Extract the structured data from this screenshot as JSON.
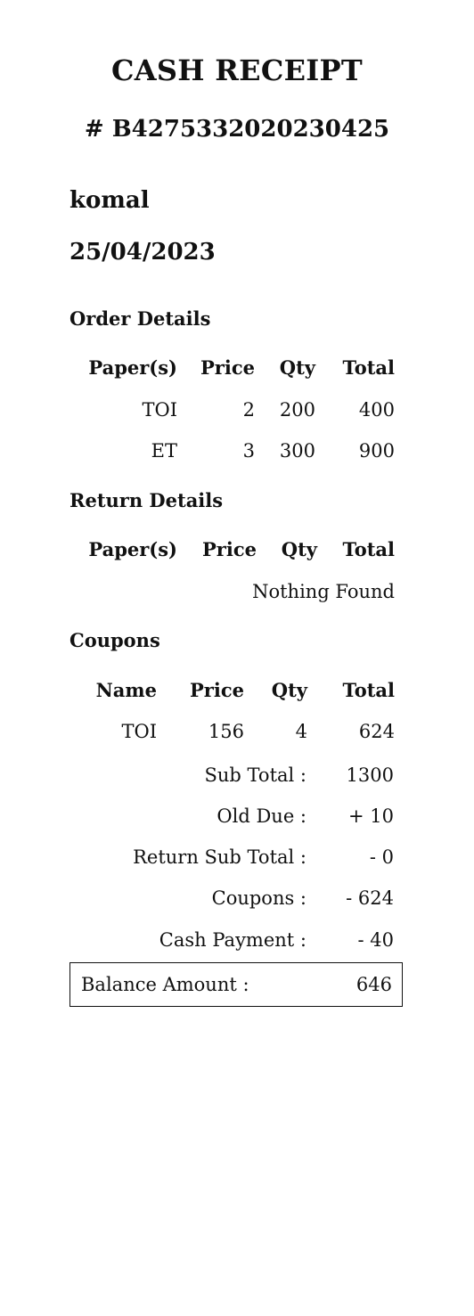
{
  "receipt": {
    "title": "CASH RECEIPT",
    "number": "# B4275332020230425",
    "customer": "komal",
    "date": "25/04/2023"
  },
  "order": {
    "section_title": "Order Details",
    "headers": [
      "Paper(s)",
      "Price",
      "Qty",
      "Total"
    ],
    "rows": [
      [
        "TOI",
        "2",
        "200",
        "400"
      ],
      [
        "ET",
        "3",
        "300",
        "900"
      ]
    ]
  },
  "returns": {
    "section_title": "Return Details",
    "headers": [
      "Paper(s)",
      "Price",
      "Qty",
      "Total"
    ],
    "empty_text": "Nothing Found"
  },
  "coupons": {
    "section_title": "Coupons",
    "headers": [
      "Name",
      "Price",
      "Qty",
      "Total"
    ],
    "rows": [
      [
        "TOI",
        "156",
        "4",
        "624"
      ]
    ]
  },
  "summary": {
    "sub_total_label": "Sub Total :",
    "sub_total_value": "1300",
    "old_due_label": "Old Due :",
    "old_due_value": "+ 10",
    "return_sub_total_label": "Return Sub Total :",
    "return_sub_total_value": "- 0",
    "coupons_label": "Coupons :",
    "coupons_value": "- 624",
    "cash_payment_label": "Cash Payment :",
    "cash_payment_value": "- 40",
    "balance_label": "Balance Amount :",
    "balance_value": "646"
  }
}
